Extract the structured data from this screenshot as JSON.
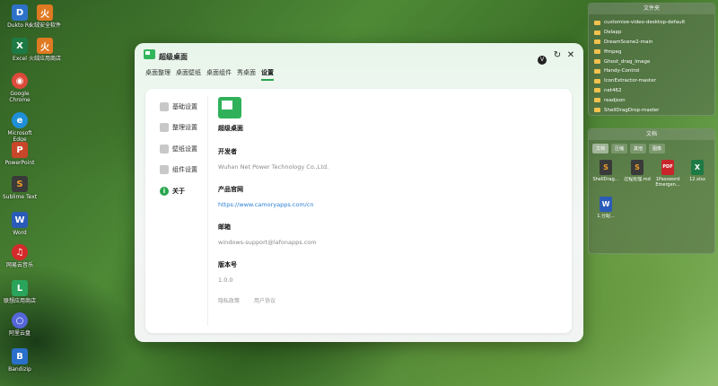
{
  "desktop": {
    "icons": [
      {
        "label": "Dukto R6",
        "color": "#2d72c8",
        "glyph": "D"
      },
      {
        "label": "火绒安全软件",
        "color": "#e07a22",
        "glyph": "火"
      },
      {
        "label": "Excel",
        "color": "#1e7a44",
        "glyph": "X"
      },
      {
        "label": "火绒应用商店",
        "color": "#e07a22",
        "glyph": "火"
      },
      {
        "label": "Google Chrome",
        "color": "#dd4a3b",
        "glyph": "◉"
      },
      {
        "label": "Microsoft Edge",
        "color": "#1f8fd8",
        "glyph": "e"
      },
      {
        "label": "PowerPoint",
        "color": "#c8462a",
        "glyph": "P"
      },
      {
        "label": "Sublime Text",
        "color": "#3a3a3a",
        "glyph": "S"
      },
      {
        "label": "Word",
        "color": "#2b5bb8",
        "glyph": "W"
      },
      {
        "label": "网易云音乐",
        "color": "#d42a2a",
        "glyph": "♫"
      },
      {
        "label": "联想应用商店",
        "color": "#2aa35b",
        "glyph": "L"
      },
      {
        "label": "阿里云盘",
        "color": "#5566d8",
        "glyph": "○"
      },
      {
        "label": "Bandizip",
        "color": "#2a6fc9",
        "glyph": "B"
      }
    ]
  },
  "window": {
    "title": "超级桌面",
    "nav": [
      "桌面整理",
      "桌面壁纸",
      "桌面组件",
      "秀桌面",
      "设置"
    ],
    "sidebar": [
      "基础设置",
      "整理设置",
      "壁纸设置",
      "组件设置",
      "关于"
    ],
    "about": {
      "app_name": "超级桌面",
      "developer_label": "开发者",
      "developer_value": "Wuhan Net Power Technology Co.,Ltd.",
      "website_label": "产品官网",
      "website_value": "https://www.camoryapps.com/cn",
      "email_label": "邮箱",
      "email_value": "windows-support@lafonapps.com",
      "version_label": "版本号",
      "version_value": "1.0.0",
      "privacy_link": "隐私政策",
      "agreement_link": "用户协议"
    },
    "controls": {
      "v_badge": "V",
      "refresh": "↻",
      "close": "✕"
    }
  },
  "folders_panel": {
    "title": "文件夹",
    "items": [
      "customize-video-desktop-default",
      "Delapp",
      "DreamScene2-main",
      "ffmpeg",
      "Ghost_drag_image",
      "Handy-Control",
      "IconExtractor-master",
      "net462",
      "readjson",
      "ShellDragDrop-master"
    ]
  },
  "docs_panel": {
    "title": "文档",
    "tabs": [
      "文档",
      "压缩",
      "其他",
      "图像"
    ],
    "files": [
      {
        "label": "ShellDrag...",
        "color": "#3a3a3a",
        "glyph": "S"
      },
      {
        "label": "过程处理.md",
        "color": "#3a3a3a",
        "glyph": "S"
      },
      {
        "label": "1Password Emergen...",
        "color": "#c8262a",
        "glyph": "PDF"
      },
      {
        "label": "12.xlsx",
        "color": "#1e7a44",
        "glyph": "X"
      },
      {
        "label": "1.分配...",
        "color": "#2b5bb8",
        "glyph": "W"
      }
    ]
  }
}
